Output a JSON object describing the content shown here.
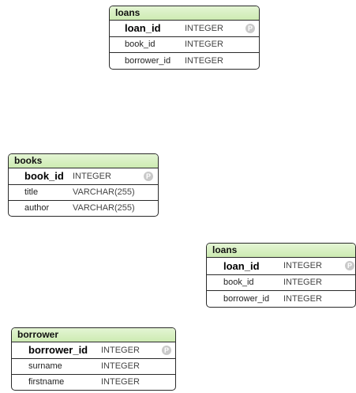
{
  "tables": {
    "loans_top": {
      "title": "loans",
      "columns": [
        {
          "name": "loan_id",
          "type": "INTEGER",
          "primary_key": true,
          "pk_marker": "P"
        },
        {
          "name": "book_id",
          "type": "INTEGER"
        },
        {
          "name": "borrower_id",
          "type": "INTEGER"
        }
      ]
    },
    "books": {
      "title": "books",
      "columns": [
        {
          "name": "book_id",
          "type": "INTEGER",
          "primary_key": true,
          "pk_marker": "P"
        },
        {
          "name": "title",
          "type": "VARCHAR(255)"
        },
        {
          "name": "author",
          "type": "VARCHAR(255)"
        }
      ]
    },
    "loans_bottom": {
      "title": "loans",
      "columns": [
        {
          "name": "loan_id",
          "type": "INTEGER",
          "primary_key": true,
          "pk_marker": "P"
        },
        {
          "name": "book_id",
          "type": "INTEGER"
        },
        {
          "name": "borrower_id",
          "type": "INTEGER"
        }
      ]
    },
    "borrower": {
      "title": "borrower",
      "columns": [
        {
          "name": "borrower_id",
          "type": "INTEGER",
          "primary_key": true,
          "pk_marker": "P"
        },
        {
          "name": "surname",
          "type": "INTEGER"
        },
        {
          "name": "firstname",
          "type": "INTEGER"
        }
      ]
    }
  },
  "colors": {
    "header_green": "#cdebb2",
    "border": "#2a2a2a",
    "pk_badge": "#c9c9c9"
  }
}
